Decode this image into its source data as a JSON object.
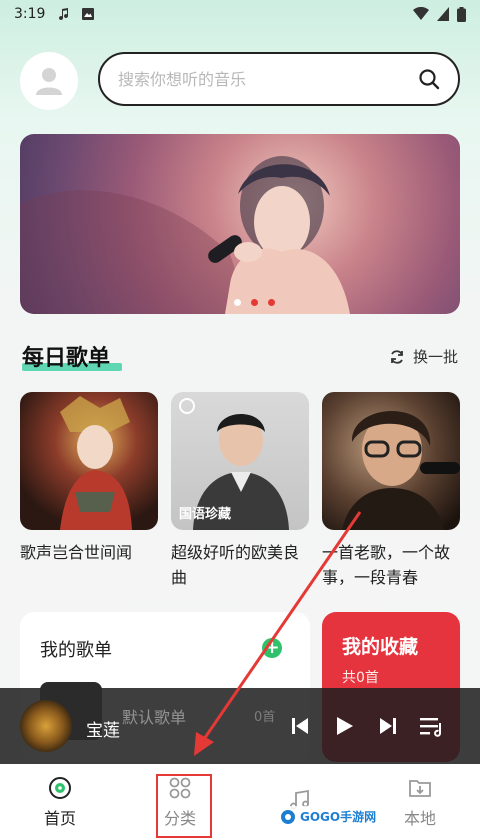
{
  "status_bar": {
    "time": "3:19"
  },
  "search": {
    "placeholder": "搜索你想听的音乐"
  },
  "banner": {
    "active_dot": 0,
    "dot_count": 3,
    "accent_color": "#e53935"
  },
  "daily": {
    "title": "每日歌单",
    "refresh_label": "换一批",
    "cards": [
      {
        "caption": "歌声岂合世间闻",
        "badge": ""
      },
      {
        "caption": "超级好听的欧美良曲",
        "badge": "国语珍藏"
      },
      {
        "caption": "一首老歌，一个故事，一段青春",
        "badge": ""
      }
    ]
  },
  "my_playlists": {
    "title": "我的歌单",
    "default_name": "默认歌单",
    "default_count": "0首"
  },
  "favorites": {
    "title": "我的收藏",
    "count": "共0首",
    "color": "#e6343f"
  },
  "player": {
    "song": "宝莲"
  },
  "tabs": [
    {
      "label": "首页",
      "icon": "disc-icon",
      "active": true
    },
    {
      "label": "分类",
      "icon": "grid-icon",
      "active": false,
      "highlighted": true
    },
    {
      "label": "",
      "icon": "music-note-icon",
      "active": false
    },
    {
      "label": "本地",
      "icon": "download-folder-icon",
      "active": false
    }
  ],
  "watermark": {
    "text": "GOGO手游网"
  }
}
